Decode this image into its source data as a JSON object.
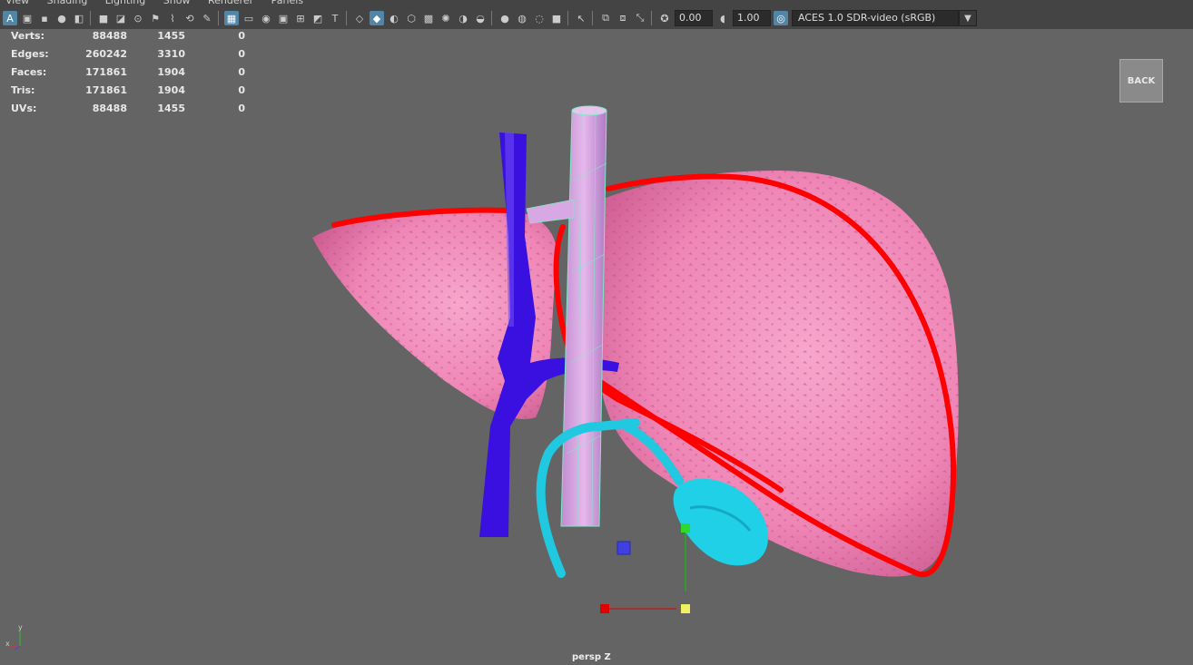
{
  "menu": [
    "View",
    "Shading",
    "Lighting",
    "Show",
    "Renderer",
    "Panels"
  ],
  "toolbar": {
    "exposure": "0.00",
    "gamma": "1.00",
    "color_space": "ACES 1.0 SDR-video (sRGB)"
  },
  "stats": [
    {
      "label": "Verts:",
      "c1": "88488",
      "c2": "1455",
      "c3": "0"
    },
    {
      "label": "Edges:",
      "c1": "260242",
      "c2": "3310",
      "c3": "0"
    },
    {
      "label": "Faces:",
      "c1": "171861",
      "c2": "1904",
      "c3": "0"
    },
    {
      "label": "Tris:",
      "c1": "171861",
      "c2": "1904",
      "c3": "0"
    },
    {
      "label": "UVs:",
      "c1": "88488",
      "c2": "1455",
      "c3": "0"
    }
  ],
  "back_label": "BACK",
  "camera_label": "persp Z",
  "axis": {
    "y": "y",
    "x": "x"
  },
  "colors": {
    "liver": "#f08ab8",
    "artery": "#ff0000",
    "portal_vein": "#3a10e0",
    "ivc": "#d8a0e0",
    "gallbladder": "#20c8e0",
    "viewport": "#646464"
  }
}
